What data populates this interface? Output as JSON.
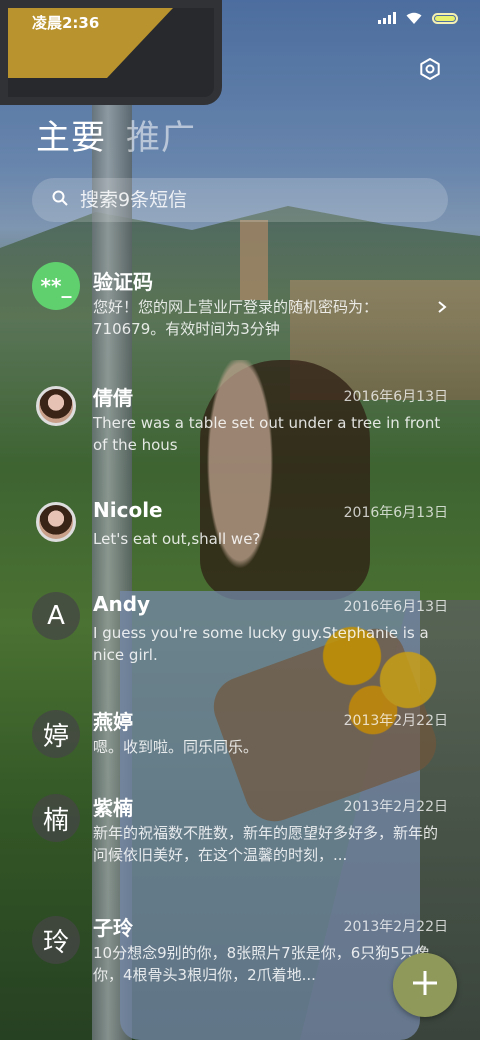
{
  "status_bar": {
    "time": "凌晨2:36"
  },
  "tabs": [
    {
      "label": "主要"
    },
    {
      "label": "推广"
    }
  ],
  "search": {
    "placeholder": "搜索9条短信"
  },
  "messages": [
    {
      "name": "验证码",
      "avatar": "**_",
      "date": "",
      "preview": "您好！您的网上营业厅登录的随机密码为：710679。有效时间为3分钟"
    },
    {
      "name": "倩倩",
      "avatar": "",
      "date": "2016年6月13日",
      "preview": "There was a table set out under a tree in front of the hous"
    },
    {
      "name": "Nicole",
      "avatar": "",
      "date": "2016年6月13日",
      "preview": "Let's eat out,shall we?"
    },
    {
      "name": "Andy",
      "avatar": "A",
      "date": "2016年6月13日",
      "preview": "I guess you're some lucky guy.Stephanie is a nice girl."
    },
    {
      "name": "燕婷",
      "avatar": "婷",
      "date": "2013年2月22日",
      "preview": "嗯。收到啦。同乐同乐。"
    },
    {
      "name": "紫楠",
      "avatar": "楠",
      "date": "2013年2月22日",
      "preview": "新年的祝福数不胜数，新年的愿望好多好多，新年的问候依旧美好，在这个温馨的时刻，..."
    },
    {
      "name": "子玲",
      "avatar": "玲",
      "date": "2013年2月22日",
      "preview": "10分想念9别的你，8张照片7张是你，6只狗5只像你，4根骨头3根归你，2爪着地..."
    }
  ],
  "colors": {
    "code_avatar": "#5fd06d",
    "fab": "#8f9a5a",
    "battery": "#e8f26d"
  },
  "icons": {
    "settings": "gear-icon",
    "search": "search-icon",
    "compose": "plus-icon",
    "expand": "chevron-right-icon"
  }
}
